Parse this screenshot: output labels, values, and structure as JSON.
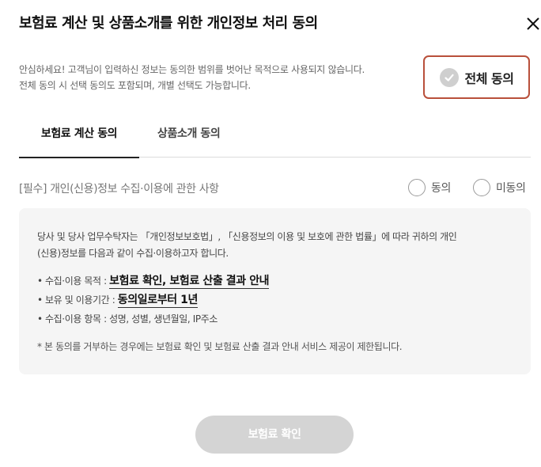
{
  "modal": {
    "title": "보험료 계산 및 상품소개를 위한 개인정보 처리 동의",
    "close_icon": "close-icon"
  },
  "notice": {
    "line1": "안심하세요! 고객님이 입력하신 정보는 동의한 범위를 벗어난 목적으로 사용되지 않습니다.",
    "line2": "전체 동의 시 선택 동의도 포함되며, 개별 선택도 가능합니다."
  },
  "all_agree": {
    "label": "전체 동의",
    "icon": "check-circle-icon",
    "checked": false,
    "border_color": "#b9503b"
  },
  "tabs": [
    {
      "label": "보험료 계산 동의",
      "active": true
    },
    {
      "label": "상품소개 동의",
      "active": false
    }
  ],
  "consent_item": {
    "title": "[필수] 개인(신용)정보 수집·이용에 관한 사항",
    "agree_label": "동의",
    "disagree_label": "미동의"
  },
  "details": {
    "intro_line1": "당사 및 당사 업무수탁자는 「개인정보보호법」, 「신용정보의 이용 및 보호에 관한 법률」에 따라 귀하의 개인",
    "intro_line2": "(신용)정보를 다음과 같이 수집·이용하고자 합니다.",
    "items": [
      {
        "label": "수집·이용 목적 : ",
        "value": "보험료 확인, 보험료 산출 결과 안내"
      },
      {
        "label": "보유 및 이용기간 : ",
        "value": "동의일로부터 1년"
      },
      {
        "label": "수집·이용 항목 : 성명, 성별, 생년월일, IP주소",
        "value": ""
      }
    ],
    "footnote": "* 본 동의를 거부하는 경우에는 보험료 확인 및 보험료 산출 결과 안내 서비스 제공이 제한됩니다."
  },
  "confirm_button": {
    "label": "보험료 확인",
    "disabled": true
  }
}
